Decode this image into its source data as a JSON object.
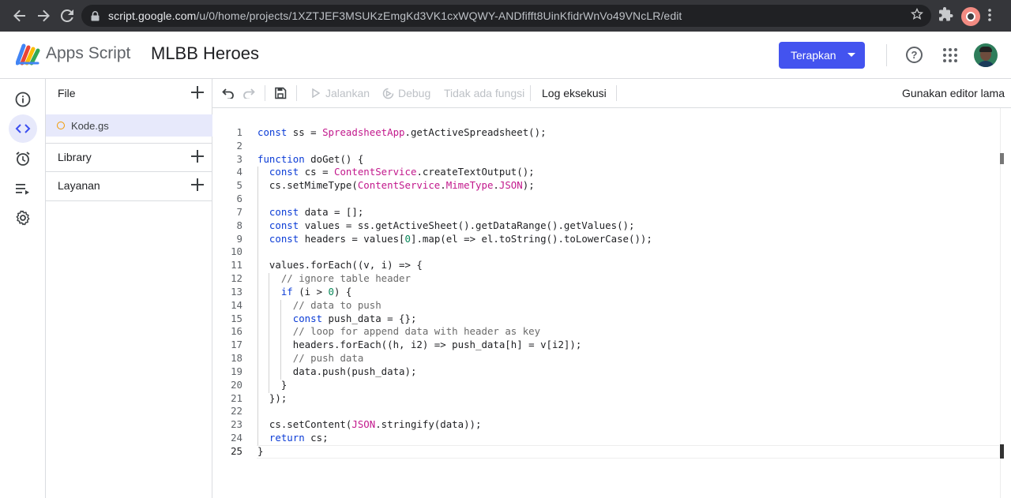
{
  "browser": {
    "url_host": "script.google.com",
    "url_path": "/u/0/home/projects/1XZTJEF3MSUKzEmgKd3VK1cxWQWY-ANDfifft8UinKfidrWnVo49VNcLR/edit"
  },
  "app": {
    "brand": "Apps Script",
    "project_title": "MLBB Heroes",
    "deploy_label": "Terapkan",
    "help_glyph": "?"
  },
  "files_panel": {
    "files_header": "File",
    "file_name": "Kode.gs",
    "library_header": "Library",
    "services_header": "Layanan"
  },
  "toolbar": {
    "run_label": "Jalankan",
    "debug_label": "Debug",
    "function_label": "Tidak ada fungsi",
    "log_label": "Log eksekusi",
    "legacy_label": "Gunakan editor lama"
  },
  "editor": {
    "line_numbers": [
      "1",
      "2",
      "3",
      "4",
      "5",
      "6",
      "7",
      "8",
      "9",
      "10",
      "11",
      "12",
      "13",
      "14",
      "15",
      "16",
      "17",
      "18",
      "19",
      "20",
      "21",
      "22",
      "23",
      "24",
      "25"
    ],
    "current_line": 25,
    "code_lines": [
      [
        [
          "kw",
          "const"
        ],
        [
          "pl",
          " ss = "
        ],
        [
          "cls",
          "SpreadsheetApp"
        ],
        [
          "pl",
          ".getActiveSpreadsheet();"
        ]
      ],
      [],
      [
        [
          "kw",
          "function"
        ],
        [
          "pl",
          " doGet() {"
        ]
      ],
      [
        [
          "pl",
          "  "
        ],
        [
          "kw",
          "const"
        ],
        [
          "pl",
          " cs = "
        ],
        [
          "cls",
          "ContentService"
        ],
        [
          "pl",
          ".createTextOutput();"
        ]
      ],
      [
        [
          "pl",
          "  cs.setMimeType("
        ],
        [
          "cls",
          "ContentService"
        ],
        [
          "pl",
          "."
        ],
        [
          "cls",
          "MimeType"
        ],
        [
          "pl",
          "."
        ],
        [
          "cls",
          "JSON"
        ],
        [
          "pl",
          ");"
        ]
      ],
      [],
      [
        [
          "pl",
          "  "
        ],
        [
          "kw",
          "const"
        ],
        [
          "pl",
          " data = [];"
        ]
      ],
      [
        [
          "pl",
          "  "
        ],
        [
          "kw",
          "const"
        ],
        [
          "pl",
          " values = ss.getActiveSheet().getDataRange().getValues();"
        ]
      ],
      [
        [
          "pl",
          "  "
        ],
        [
          "kw",
          "const"
        ],
        [
          "pl",
          " headers = values["
        ],
        [
          "num",
          "0"
        ],
        [
          "pl",
          "].map(el => el.toString().toLowerCase());"
        ]
      ],
      [],
      [
        [
          "pl",
          "  values.forEach((v, i) => {"
        ]
      ],
      [
        [
          "pl",
          "    "
        ],
        [
          "cmt",
          "// ignore table header"
        ]
      ],
      [
        [
          "pl",
          "    "
        ],
        [
          "kw",
          "if"
        ],
        [
          "pl",
          " (i > "
        ],
        [
          "num",
          "0"
        ],
        [
          "pl",
          ") {"
        ]
      ],
      [
        [
          "pl",
          "      "
        ],
        [
          "cmt",
          "// data to push"
        ]
      ],
      [
        [
          "pl",
          "      "
        ],
        [
          "kw",
          "const"
        ],
        [
          "pl",
          " push_data = {};"
        ]
      ],
      [
        [
          "pl",
          "      "
        ],
        [
          "cmt",
          "// loop for append data with header as key"
        ]
      ],
      [
        [
          "pl",
          "      headers.forEach((h, i2) => push_data[h] = v[i2]);"
        ]
      ],
      [
        [
          "pl",
          "      "
        ],
        [
          "cmt",
          "// push data"
        ]
      ],
      [
        [
          "pl",
          "      data.push(push_data);"
        ]
      ],
      [
        [
          "pl",
          "    }"
        ]
      ],
      [
        [
          "pl",
          "  });"
        ]
      ],
      [],
      [
        [
          "pl",
          "  cs.setContent("
        ],
        [
          "cls",
          "JSON"
        ],
        [
          "pl",
          ".stringify(data));"
        ]
      ],
      [
        [
          "pl",
          "  "
        ],
        [
          "kw",
          "return"
        ],
        [
          "pl",
          " cs;"
        ]
      ],
      [
        [
          "pl",
          "}"
        ]
      ]
    ]
  },
  "colors": {
    "accent": "#4353ef",
    "keyword": "#0a3bd6",
    "class": "#c2188c",
    "number": "#09885a",
    "comment": "#6a6a6a"
  }
}
